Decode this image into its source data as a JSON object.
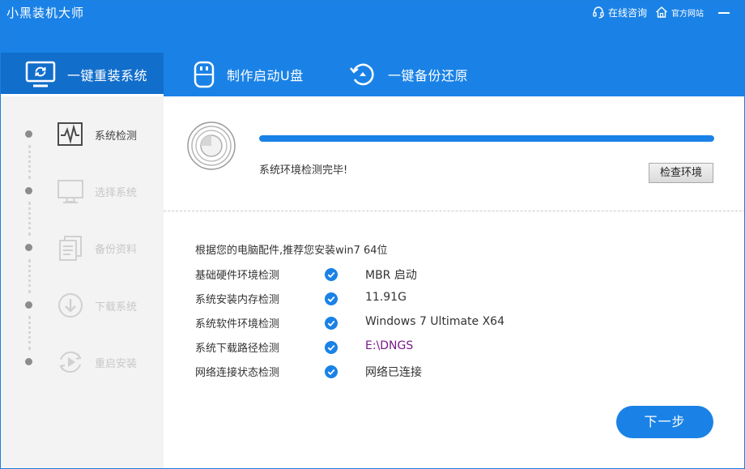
{
  "window": {
    "title": "小黑装机大师",
    "links": [
      {
        "label": "在线咨询",
        "icon": "headset-icon"
      },
      {
        "label": "官方网站",
        "icon": "home-icon"
      }
    ]
  },
  "tabs": [
    {
      "label": "一键重装系统",
      "icon": "monitor-refresh-icon",
      "active": true
    },
    {
      "label": "制作启动U盘",
      "icon": "usb-icon",
      "active": false
    },
    {
      "label": "一键备份还原",
      "icon": "restore-icon",
      "active": false
    }
  ],
  "steps": [
    {
      "label": "系统检测",
      "icon": "pulse-monitor-icon",
      "active": true
    },
    {
      "label": "选择系统",
      "icon": "desktop-icon",
      "active": false
    },
    {
      "label": "备份资料",
      "icon": "documents-icon",
      "active": false
    },
    {
      "label": "下载系统",
      "icon": "download-icon",
      "active": false
    },
    {
      "label": "重启安装",
      "icon": "reboot-icon",
      "active": false
    }
  ],
  "detection": {
    "progress_percent": 100,
    "status": "系统环境检测完毕!",
    "check_button": "检查环境"
  },
  "recommendation": "根据您的电脑配件,推荐您安装win7 64位",
  "checks": [
    {
      "label": "基础硬件环境检测",
      "value": "MBR 启动"
    },
    {
      "label": "系统安装内存检测",
      "value": "11.91G"
    },
    {
      "label": "系统软件环境检测",
      "value": "Windows 7 Ultimate X64"
    },
    {
      "label": "系统下载路径检测",
      "value": "E:\\DNGS"
    },
    {
      "label": "网络连接状态检测",
      "value": "网络已连接"
    }
  ],
  "next_button": "下一步",
  "colors": {
    "brand_blue": "#1a82e6",
    "active_tab": "#126ecb",
    "sidebar_bg": "#f3f3f3",
    "path_purple": "#7a1a8a"
  }
}
